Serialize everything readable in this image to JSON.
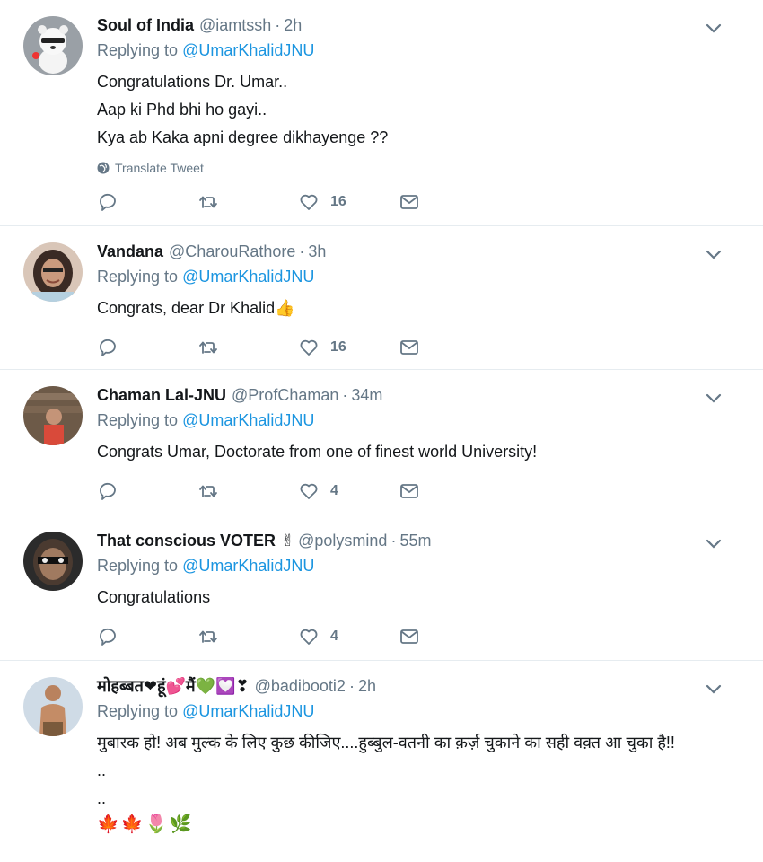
{
  "tweets": [
    {
      "name": "Soul of India",
      "name_emojis": "",
      "handle": "@iamtssh",
      "time": "2h",
      "replying_prefix": "Replying to ",
      "replying_to": "@UmarKhalidJNU",
      "text": "Congratulations Dr. Umar..\nAap ki Phd bhi ho gayi..\nKya ab Kaka apni degree dikhayenge ??",
      "translate_label": "Translate Tweet",
      "likes": "16",
      "avatar_icon": "avatar-panda"
    },
    {
      "name": "Vandana",
      "name_emojis": "",
      "handle": "@CharouRathore",
      "time": "3h",
      "replying_prefix": "Replying to ",
      "replying_to": "@UmarKhalidJNU",
      "text": "Congrats, dear Dr Khalid",
      "text_emoji": "👍",
      "likes": "16",
      "avatar_icon": "avatar-woman"
    },
    {
      "name": "Chaman Lal-JNU",
      "name_emojis": "",
      "handle": "@ProfChaman",
      "time": "34m",
      "replying_prefix": "Replying to ",
      "replying_to": "@UmarKhalidJNU",
      "text": "Congrats Umar, Doctorate from one of finest world University!",
      "likes": "4",
      "avatar_icon": "avatar-man-library"
    },
    {
      "name": "That conscious VOTER",
      "name_emojis": "✌",
      "handle": "@polysmind",
      "time": "55m",
      "replying_prefix": "Replying to ",
      "replying_to": "@UmarKhalidJNU",
      "text": "Congratulations",
      "likes": "4",
      "avatar_icon": "avatar-face-mask"
    },
    {
      "name": "मोहब्बत❤हूं💕मैं💚💟❣",
      "name_emojis": "",
      "handle": "@badibooti2",
      "time": "2h",
      "replying_prefix": "Replying to ",
      "replying_to": "@UmarKhalidJNU",
      "text": "मुबारक हो! अब मुल्क के लिए कुछ कीजिए....हुब्बुल-वतनी का क़र्ज़ चुकाने का सही वक़्त आ चुका है!!\n..\n..",
      "tail_emojis": "🍁🍁🌷🌿",
      "avatar_icon": "avatar-man-shirtless"
    }
  ],
  "colors": {
    "accent": "#1b95e0",
    "secondary": "#657786",
    "border": "#e6ecf0"
  }
}
